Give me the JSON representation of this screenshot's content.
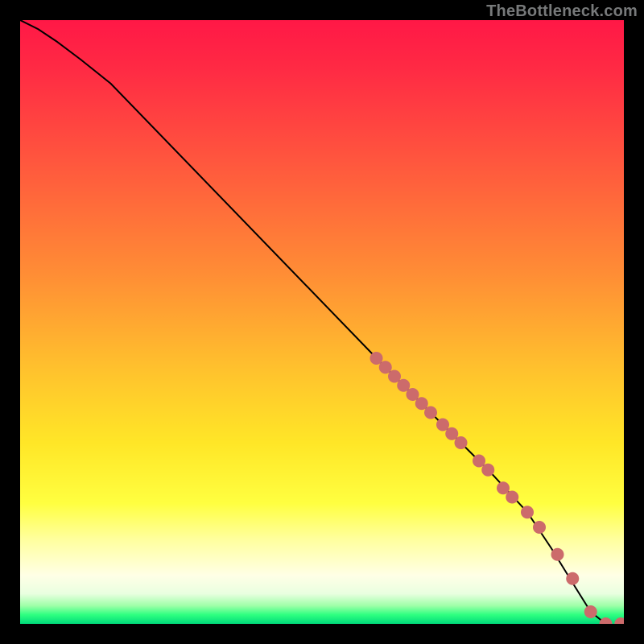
{
  "watermark_text": "TheBottleneck.com",
  "colors": {
    "marker": "#cc6b6b",
    "curve": "#000000"
  },
  "chart_data": {
    "type": "line",
    "title": "",
    "xlabel": "",
    "ylabel": "",
    "xlim": [
      0,
      100
    ],
    "ylim": [
      0,
      100
    ],
    "grid": false,
    "legend": false,
    "series": [
      {
        "name": "curve",
        "kind": "line",
        "x": [
          0,
          3,
          6,
          10,
          15,
          60,
          70,
          78,
          84,
          88,
          92,
          94.5,
          97
        ],
        "y": [
          100,
          98.5,
          96.5,
          93.5,
          89.5,
          43,
          33,
          25,
          18.5,
          12.5,
          6,
          2,
          0
        ]
      },
      {
        "name": "markers",
        "kind": "scatter",
        "x": [
          59,
          60.5,
          62,
          63.5,
          65,
          66.5,
          68,
          70,
          71.5,
          73,
          76,
          77.5,
          80,
          81.5,
          84,
          86,
          89,
          91.5,
          94.5,
          97,
          99.5
        ],
        "y": [
          44,
          42.5,
          41,
          39.5,
          38,
          36.5,
          35,
          33,
          31.5,
          30,
          27,
          25.5,
          22.5,
          21,
          18.5,
          16,
          11.5,
          7.5,
          2,
          0,
          0
        ]
      }
    ]
  }
}
